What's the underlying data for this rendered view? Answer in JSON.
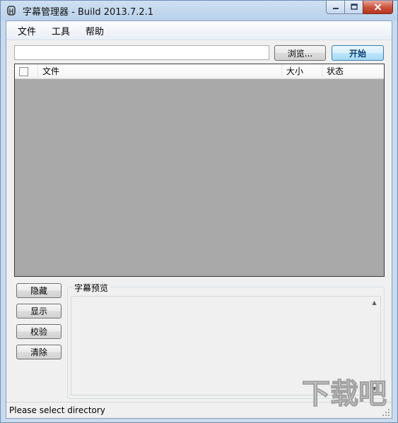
{
  "window": {
    "title": "字幕管理器 - Build 2013.7.2.1"
  },
  "menu": {
    "items": [
      "文件",
      "工具",
      "帮助"
    ]
  },
  "toolbar": {
    "path_value": "",
    "browse_label": "浏览...",
    "start_label": "开始"
  },
  "file_list": {
    "columns": [
      "文件",
      "大小",
      "状态"
    ],
    "rows": []
  },
  "actions": {
    "hide_label": "隐藏",
    "show_label": "显示",
    "verify_label": "校验",
    "clear_label": "清除"
  },
  "preview": {
    "label": "字幕预览",
    "content": ""
  },
  "status": {
    "text": "Please select directory"
  },
  "watermark": {
    "text": "下载吧"
  },
  "colors": {
    "list_background": "#a9a9a9",
    "close_button": "#c9503a",
    "start_text": "#0a3f7a"
  },
  "icons": [
    "app-icon",
    "minimize-icon",
    "maximize-icon",
    "close-icon",
    "scroll-up-icon",
    "scroll-down-icon",
    "size-grip-icon"
  ]
}
